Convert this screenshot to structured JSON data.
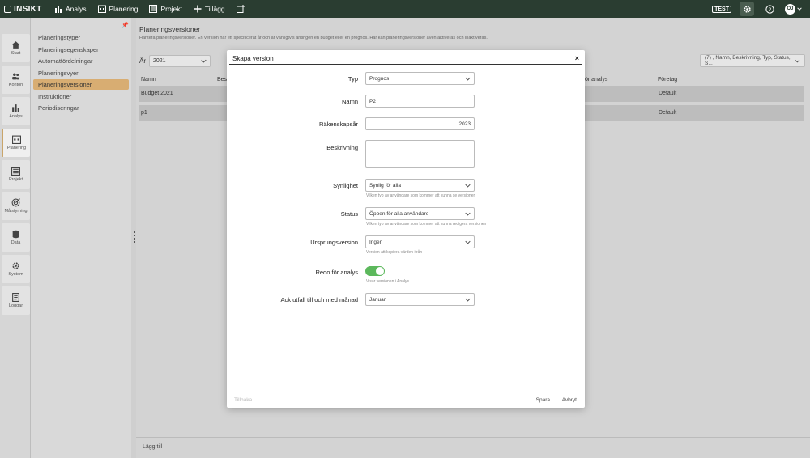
{
  "topbar": {
    "logo": "INSIKT",
    "nav": [
      {
        "label": "Analys",
        "icon": "bar-chart-icon"
      },
      {
        "label": "Planering",
        "icon": "calendar-icon"
      },
      {
        "label": "Projekt",
        "icon": "list-icon"
      },
      {
        "label": "Tillägg",
        "icon": "plus-icon"
      }
    ],
    "test_badge": "TEST",
    "avatar": "OJ"
  },
  "rail": [
    {
      "label": "Start",
      "icon": "home-icon"
    },
    {
      "label": "Konton",
      "icon": "users-icon"
    },
    {
      "label": "Analys",
      "icon": "bar-chart-icon"
    },
    {
      "label": "Planering",
      "icon": "calendar-icon"
    },
    {
      "label": "Projekt",
      "icon": "list-icon"
    },
    {
      "label": "Målstyrning",
      "icon": "target-icon"
    },
    {
      "label": "Data",
      "icon": "database-icon"
    },
    {
      "label": "System",
      "icon": "gear-icon"
    },
    {
      "label": "Loggar",
      "icon": "log-icon"
    }
  ],
  "submenu": [
    "Planeringstyper",
    "Planeringsegenskaper",
    "Automatfördelningar",
    "Planeringsvyer",
    "Planeringsversioner",
    "Instruktioner",
    "Periodiseringar"
  ],
  "main": {
    "title": "Planeringsversioner",
    "description": "Hantera planeringsversioner. En version har ett specificerat år och är vanligtvis antingen en budget eller en prognos. Här kan planeringsversioner även aktiveras och inaktiveras.",
    "year_label": "År",
    "year_value": "2021",
    "filter_value": "(7) , Namn, Beskrivning, Typ, Status, S...",
    "columns": [
      "Namn",
      "Bes",
      "för analys",
      "Företag"
    ],
    "rows": [
      {
        "name": "Budget 2021",
        "company": "Default"
      },
      {
        "name": "p1",
        "company": "Default"
      }
    ],
    "add_label": "Lägg till"
  },
  "modal": {
    "title": "Skapa version",
    "close": "×",
    "fields": {
      "typ": {
        "label": "Typ",
        "value": "Prognos"
      },
      "namn": {
        "label": "Namn",
        "value": "P2"
      },
      "rakenskapsar": {
        "label": "Räkenskapsår",
        "value": "2023"
      },
      "beskrivning": {
        "label": "Beskrivning",
        "value": ""
      },
      "synlighet": {
        "label": "Synlighet",
        "value": "Synlig för alla",
        "hint": "Vilken typ av användare som kommer att kunna se versionen"
      },
      "status": {
        "label": "Status",
        "value": "Öppen för alla användare",
        "hint": "Vilken typ av användare som kommer att kunna redigera versionen"
      },
      "ursprungsversion": {
        "label": "Ursprungsversion",
        "value": "Ingen",
        "hint": "Version att kopiera värden ifrån"
      },
      "redo": {
        "label": "Redo för analys",
        "hint": "Visar versionen i Analys",
        "on": true
      },
      "ack": {
        "label": "Ack utfall till och med månad",
        "value": "Januari"
      }
    },
    "footer": {
      "back": "Tillbaka",
      "save": "Spara",
      "cancel": "Avbryt"
    }
  }
}
